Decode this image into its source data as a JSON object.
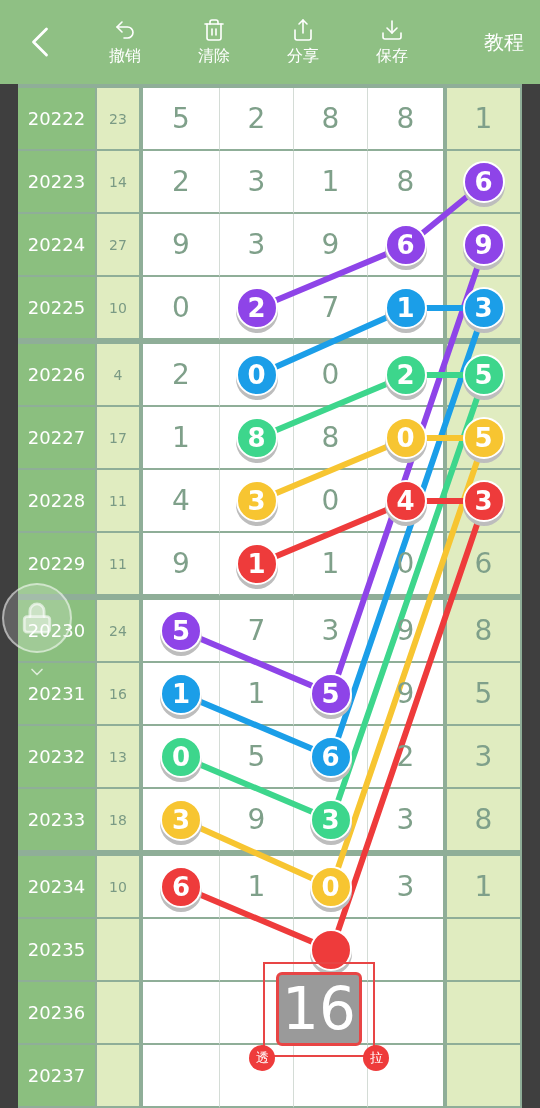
{
  "toolbar": {
    "tools": [
      {
        "kind": "undo",
        "label": "撤销"
      },
      {
        "kind": "clear",
        "label": "清除"
      },
      {
        "kind": "share",
        "label": "分享"
      },
      {
        "kind": "save",
        "label": "保存"
      }
    ],
    "tutorial": "教程"
  },
  "rows": [
    {
      "period": "20222",
      "sum": "23",
      "cells": [
        {
          "value": "5"
        },
        {
          "value": "2"
        },
        {
          "value": "8"
        },
        {
          "value": "8"
        },
        {
          "value": "1"
        }
      ]
    },
    {
      "period": "20223",
      "sum": "14",
      "cells": [
        {
          "value": "2"
        },
        {
          "value": "3"
        },
        {
          "value": "1"
        },
        {
          "value": "8"
        },
        {
          "value": "6",
          "color": "#8e44e8"
        }
      ]
    },
    {
      "period": "20224",
      "sum": "27",
      "cells": [
        {
          "value": "9"
        },
        {
          "value": "3"
        },
        {
          "value": "9"
        },
        {
          "value": "6",
          "color": "#8e44e8"
        },
        {
          "value": "9",
          "color": "#8e44e8"
        }
      ]
    },
    {
      "period": "20225",
      "sum": "10",
      "cells": [
        {
          "value": "0"
        },
        {
          "value": "2",
          "color": "#8e44e8"
        },
        {
          "value": "7"
        },
        {
          "value": "1",
          "color": "#1b9ee8"
        },
        {
          "value": "3",
          "color": "#1b9ee8"
        }
      ]
    },
    {
      "period": "20226",
      "sum": "4",
      "cells": [
        {
          "value": "2"
        },
        {
          "value": "0",
          "color": "#1b9ee8"
        },
        {
          "value": "0"
        },
        {
          "value": "2",
          "color": "#3dd68c"
        },
        {
          "value": "5",
          "color": "#3dd68c"
        }
      ]
    },
    {
      "period": "20227",
      "sum": "17",
      "cells": [
        {
          "value": "1"
        },
        {
          "value": "8",
          "color": "#3dd68c"
        },
        {
          "value": "8"
        },
        {
          "value": "0",
          "color": "#f7c531"
        },
        {
          "value": "5",
          "color": "#f7c531"
        }
      ]
    },
    {
      "period": "20228",
      "sum": "11",
      "cells": [
        {
          "value": "4"
        },
        {
          "value": "3",
          "color": "#f7c531"
        },
        {
          "value": "0"
        },
        {
          "value": "4",
          "color": "#ee3b3b"
        },
        {
          "value": "3",
          "color": "#ee3b3b"
        }
      ]
    },
    {
      "period": "20229",
      "sum": "11",
      "cells": [
        {
          "value": "9"
        },
        {
          "value": "1",
          "color": "#ee3b3b"
        },
        {
          "value": "1"
        },
        {
          "value": "0"
        },
        {
          "value": "6"
        }
      ]
    },
    {
      "period": "20230",
      "sum": "24",
      "cells": [
        {
          "value": "5",
          "color": "#8e44e8"
        },
        {
          "value": "7"
        },
        {
          "value": "3"
        },
        {
          "value": "9"
        },
        {
          "value": "8"
        }
      ]
    },
    {
      "period": "20231",
      "sum": "16",
      "cells": [
        {
          "value": "1",
          "color": "#1b9ee8"
        },
        {
          "value": "1"
        },
        {
          "value": "5",
          "color": "#8e44e8"
        },
        {
          "value": "9"
        },
        {
          "value": "5"
        }
      ]
    },
    {
      "period": "20232",
      "sum": "13",
      "cells": [
        {
          "value": "0",
          "color": "#3dd68c"
        },
        {
          "value": "5"
        },
        {
          "value": "6",
          "color": "#1b9ee8"
        },
        {
          "value": "2"
        },
        {
          "value": "3"
        }
      ]
    },
    {
      "period": "20233",
      "sum": "18",
      "cells": [
        {
          "value": "3",
          "color": "#f7c531"
        },
        {
          "value": "9"
        },
        {
          "value": "3",
          "color": "#3dd68c"
        },
        {
          "value": "3"
        },
        {
          "value": "8"
        }
      ]
    },
    {
      "period": "20234",
      "sum": "10",
      "cells": [
        {
          "value": "6",
          "color": "#ee3b3b"
        },
        {
          "value": "1"
        },
        {
          "value": "0",
          "color": "#f7c531"
        },
        {
          "value": "3"
        },
        {
          "value": "1"
        }
      ]
    },
    {
      "period": "20235",
      "cells": [
        {},
        {},
        {
          "color": "#ee3b3b"
        },
        {},
        {}
      ]
    },
    {
      "period": "20236",
      "cells": [
        {},
        {},
        {},
        {},
        {}
      ]
    },
    {
      "period": "20237",
      "cells": [
        {},
        {},
        {},
        {},
        {}
      ]
    }
  ],
  "selection": {
    "value": "16",
    "left_badge": "透",
    "right_badge": "拉"
  }
}
